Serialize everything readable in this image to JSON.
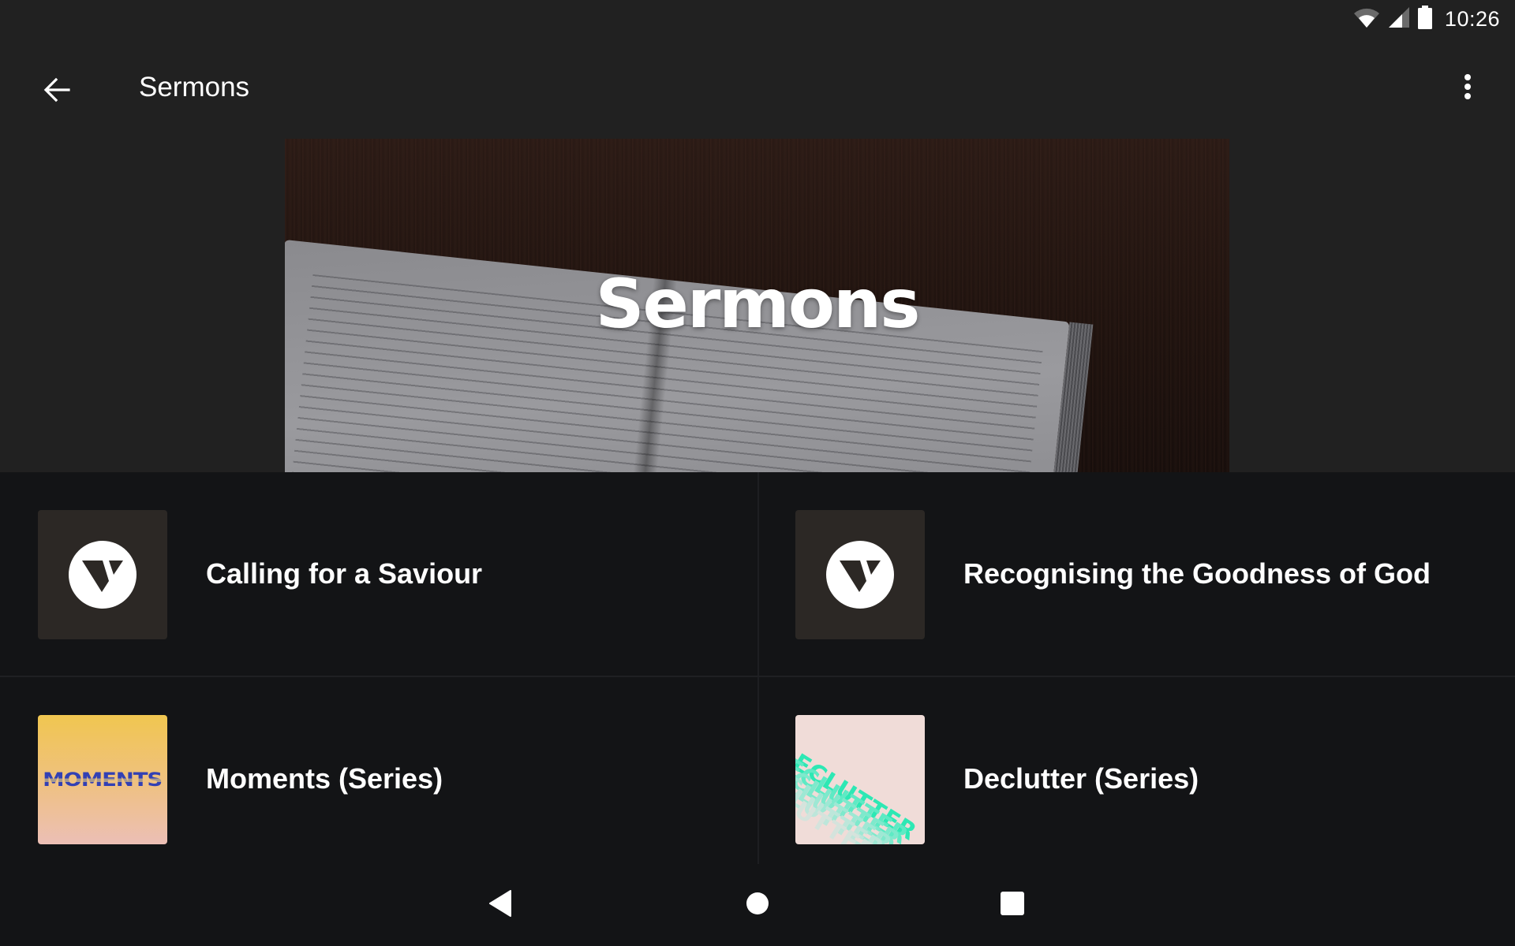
{
  "status_bar": {
    "time": "10:26",
    "icons": [
      "wifi-icon",
      "cellular-signal-icon",
      "battery-icon"
    ]
  },
  "app_bar": {
    "title": "Sermons",
    "back_icon": "arrow-back-icon",
    "menu_icon": "more-vert-icon"
  },
  "hero": {
    "title": "Sermons",
    "image": "open-bible-on-dark-wood"
  },
  "items": [
    {
      "title": "Calling for a Saviour",
      "thumbnail": "v-logo"
    },
    {
      "title": "Recognising the Goodness of God",
      "thumbnail": "v-logo"
    },
    {
      "title": "Moments (Series)",
      "thumbnail": "moments-artwork",
      "thumbnail_text": "MOMENTS"
    },
    {
      "title": "Declutter (Series)",
      "thumbnail": "declutter-artwork",
      "thumbnail_text": "DECLUTTER"
    }
  ],
  "colors": {
    "app_bar_bg": "#212121",
    "content_bg": "#131416",
    "v_logo_bg": "#2c2825",
    "moments_text": "#3240b4",
    "declutter_accent": "#2de8b4"
  },
  "nav_bar": {
    "back": "nav-back-icon",
    "home": "nav-home-icon",
    "recents": "nav-recents-icon"
  }
}
